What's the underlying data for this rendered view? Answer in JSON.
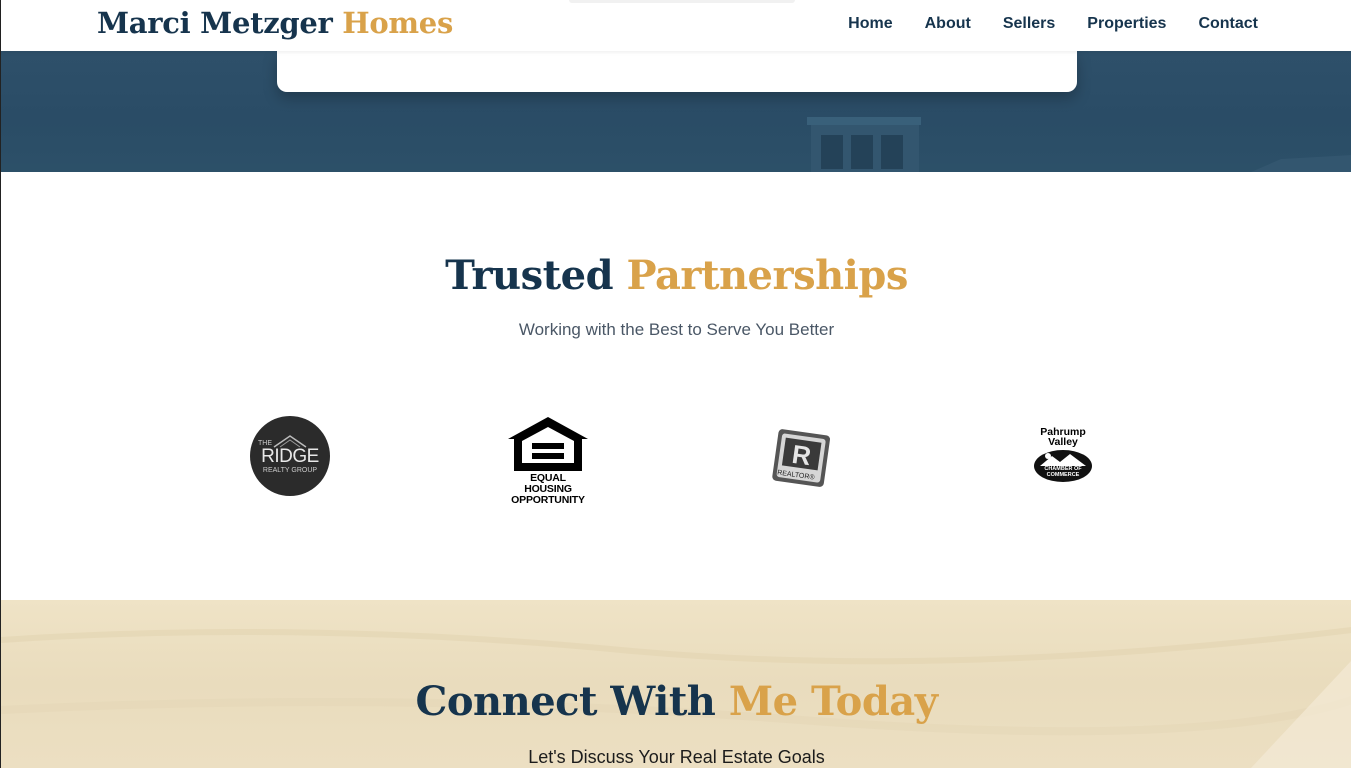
{
  "header": {
    "brand_part1": "Marci Metzger",
    "brand_part2": "Homes",
    "nav": [
      "Home",
      "About",
      "Sellers",
      "Properties",
      "Contact"
    ]
  },
  "partners": {
    "title_part1": "Trusted",
    "title_part2": "Partnerships",
    "subtitle": "Working with the Best to Serve You Better",
    "logos": {
      "ridge": {
        "small_top": "THE",
        "main": "RIDGE",
        "small_bottom": "REALTY GROUP"
      },
      "equal_housing": {
        "line1": "EQUAL HOUSING",
        "line2": "OPPORTUNITY"
      },
      "realtor": {
        "mark": "R",
        "label": "REALTOR®"
      },
      "pahrump": {
        "line1": "Pahrump",
        "line2": "Valley",
        "line3": "CHAMBER OF COMMERCE"
      }
    }
  },
  "connect": {
    "title_part1": "Connect With",
    "title_part2": "Me Today",
    "subtitle": "Let's Discuss Your Real Estate Goals"
  },
  "colors": {
    "navy": "#16344d",
    "gold": "#d9a24a",
    "hero": "#2e506a",
    "sand": "#efe3c6"
  }
}
